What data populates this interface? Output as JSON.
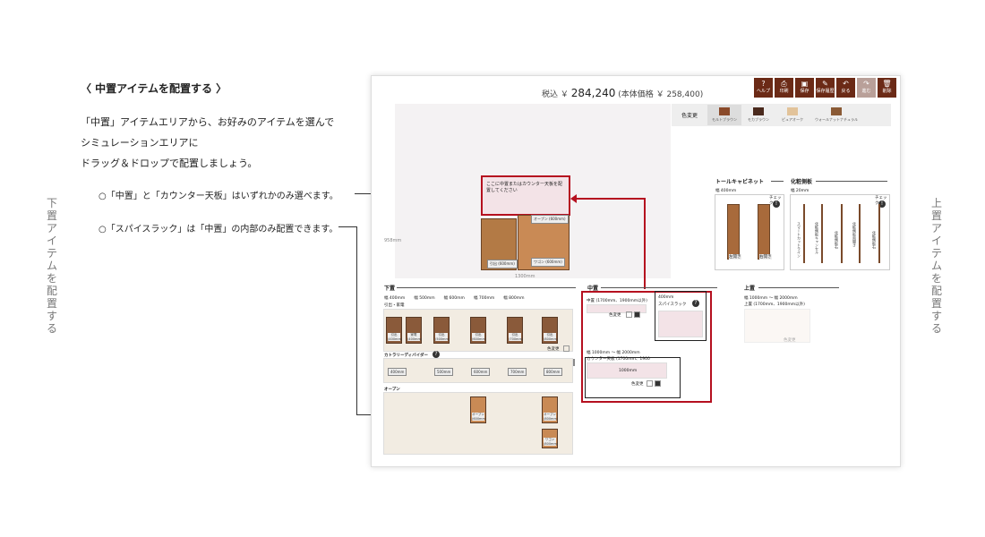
{
  "side": {
    "left_title": "下置アイテムを配置する",
    "right_title": "上置アイテムを配置する"
  },
  "guide": {
    "title": "〈 中置アイテムを配置する 〉",
    "body": [
      "「中置」アイテムエリアから、お好みのアイテムを選んで",
      "シミュレーションエリアに",
      "ドラッグ＆ドロップで配置しましょう。"
    ],
    "note1": "○「中置」と「カウンター天板」はいずれかのみ選べます。",
    "note2": "○「スパイスラック」は「中置」の内部のみ配置できます。"
  },
  "app": {
    "price_prefix": "税込 ￥",
    "price_value": "284,240",
    "price_sub": "(本体価格 ￥ 258,400)",
    "toolbar": [
      {
        "icon": "?",
        "label": "ヘルプ",
        "icon_name": "help-icon",
        "disabled": false
      },
      {
        "icon": "⎙",
        "label": "印刷",
        "icon_name": "print-icon",
        "disabled": false
      },
      {
        "icon": "▣",
        "label": "保存",
        "icon_name": "save-icon",
        "disabled": false
      },
      {
        "icon": "✎",
        "label": "保存履歴",
        "icon_name": "history-icon",
        "disabled": false
      },
      {
        "icon": "↶",
        "label": "戻る",
        "icon_name": "undo-icon",
        "disabled": false
      },
      {
        "icon": "↷",
        "label": "進む",
        "icon_name": "redo-icon",
        "disabled": true
      },
      {
        "icon": "🗑",
        "label": "削除",
        "icon_name": "trash-icon",
        "disabled": false
      }
    ],
    "color_label": "色変更",
    "swatches": [
      {
        "label": "モルトブラウン",
        "color": "#8a4a2a",
        "selected": true
      },
      {
        "label": "モカブラウン",
        "color": "#4a2a1d",
        "selected": false
      },
      {
        "label": "ピュアオーク",
        "color": "#e2c39a",
        "selected": false
      },
      {
        "label": "ウォールナットナチュラル",
        "color": "#8a5a35",
        "selected": false
      }
    ],
    "sim": {
      "drop_text": "ここに中置またはカウンター天板を配置してください",
      "open_label": "オープン (600mm)",
      "wagon_label": "ワゴン (600mm)",
      "drawer_label": "引出 (600mm)",
      "height_dim": "958mm",
      "width_dim": "1300mm"
    },
    "lower": {
      "title": "下置",
      "widths": [
        "幅 400mm",
        "幅 500mm",
        "幅 600mm",
        "幅 700mm",
        "幅 800mm"
      ],
      "sub1": "引出・家電",
      "items": [
        "引出 (400mm)",
        "家電 (400mm)",
        "引出 (500mm)",
        "引出 (600mm)",
        "引出 (700mm)",
        "引出 (800mm)"
      ],
      "color_change": "色変更",
      "divider_title": "カトラリーディバイダー",
      "option": "オプション",
      "divider_items": [
        "400mm",
        "500mm",
        "600mm",
        "700mm",
        "800mm"
      ],
      "open_title": "オープン",
      "open_items": [
        "オープン (600mm)",
        "オープン (800mm)",
        "ワゴン (800mm)"
      ]
    },
    "middle": {
      "title": "中置",
      "item1": "中置",
      "item1_sub": "(1700mm、1900mm以外)",
      "color_change": "色変更",
      "counter_range": "幅 1000mm 〜 幅 2000mm",
      "counter_title": "カウンター天板",
      "counter_sub": "(1700mm、1900",
      "counter_item": "1000mm",
      "spice_width": "400mm",
      "spice_title": "スパイスラック"
    },
    "tall": {
      "title": "トールキャビネット",
      "width": "幅 400mm",
      "items": [
        "左開き",
        "右開き"
      ],
      "check": "チェック"
    },
    "side_panel": {
      "title": "化粧側板",
      "width": "幅 20mm",
      "items": [
        "スマートカットライン",
        "化粧側板キャンセル",
        "化粧側板右",
        "化粧側板両開き",
        "化粧側板右"
      ],
      "check": "チェック"
    },
    "upper": {
      "title": "上置",
      "range": "幅 1000mm 〜 幅 2000mm",
      "sub": "上置 (1700mm、1900mm以外)",
      "color_change": "色変更"
    }
  }
}
